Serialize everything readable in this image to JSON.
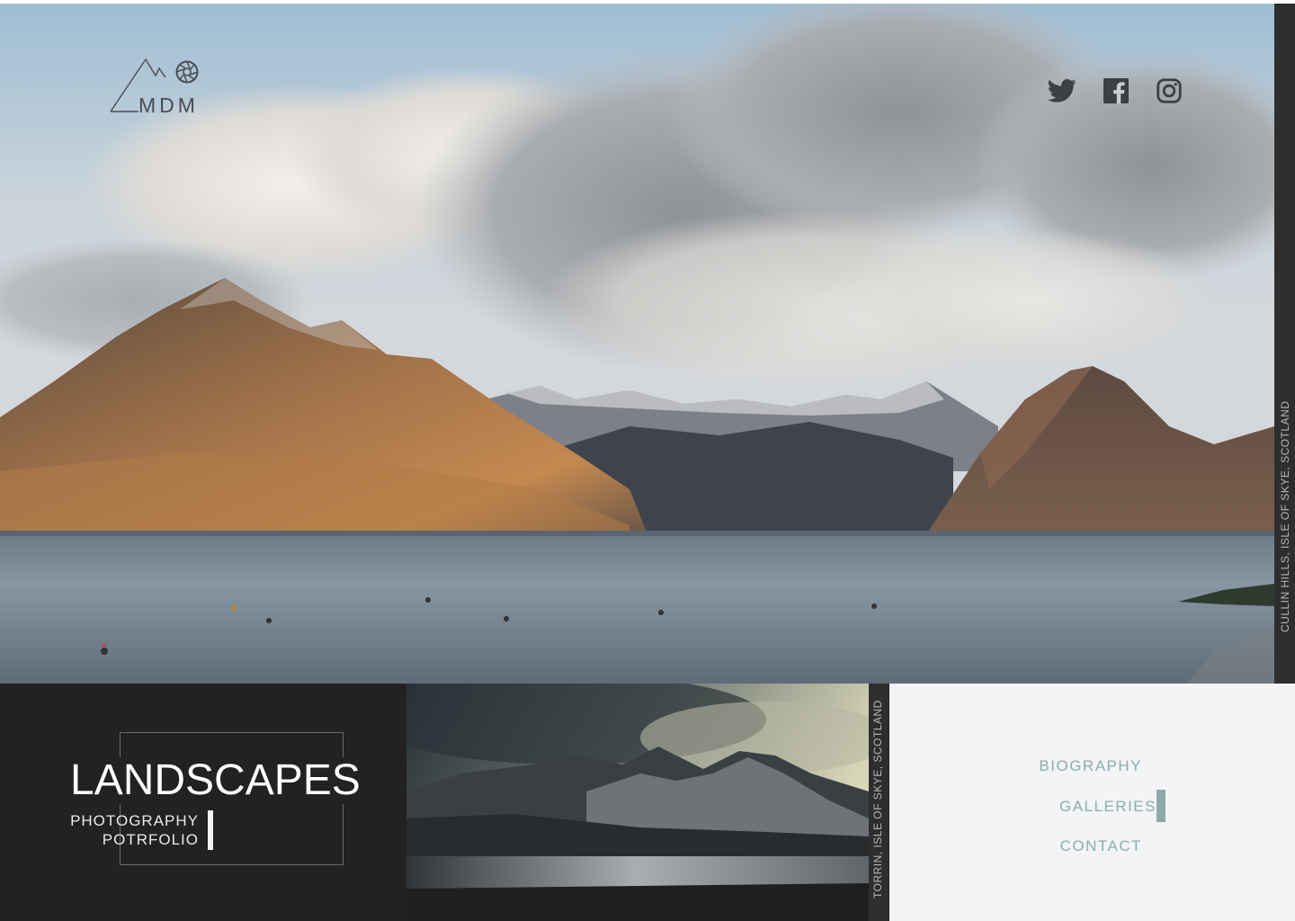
{
  "logo": {
    "text": "MDM",
    "icon": "camera-aperture-icon"
  },
  "social": [
    {
      "name": "twitter",
      "icon": "twitter-icon"
    },
    {
      "name": "facebook",
      "icon": "facebook-icon"
    },
    {
      "name": "instagram",
      "icon": "instagram-icon"
    }
  ],
  "hero": {
    "caption": "CULLIN HILLS, ISLE OF SKYE, SCOTLAND"
  },
  "title": {
    "main": "LANDSCAPES",
    "sub_line1": "PHOTOGRAPHY",
    "sub_line2": "POTRFOLIO"
  },
  "secondary_photo": {
    "caption": "TORRIN, ISLE OF SKYE, SCOTLAND"
  },
  "nav": {
    "items": [
      "BIOGRAPHY",
      "GALLERIES",
      "CONTACT"
    ],
    "active": "GALLERIES"
  },
  "colors": {
    "dark_panel": "#222222",
    "side_bar": "#2e2e2e",
    "nav_text": "#8aaeae",
    "nav_indicator": "#8fa9aa",
    "nav_background": "#f2f4f6"
  }
}
